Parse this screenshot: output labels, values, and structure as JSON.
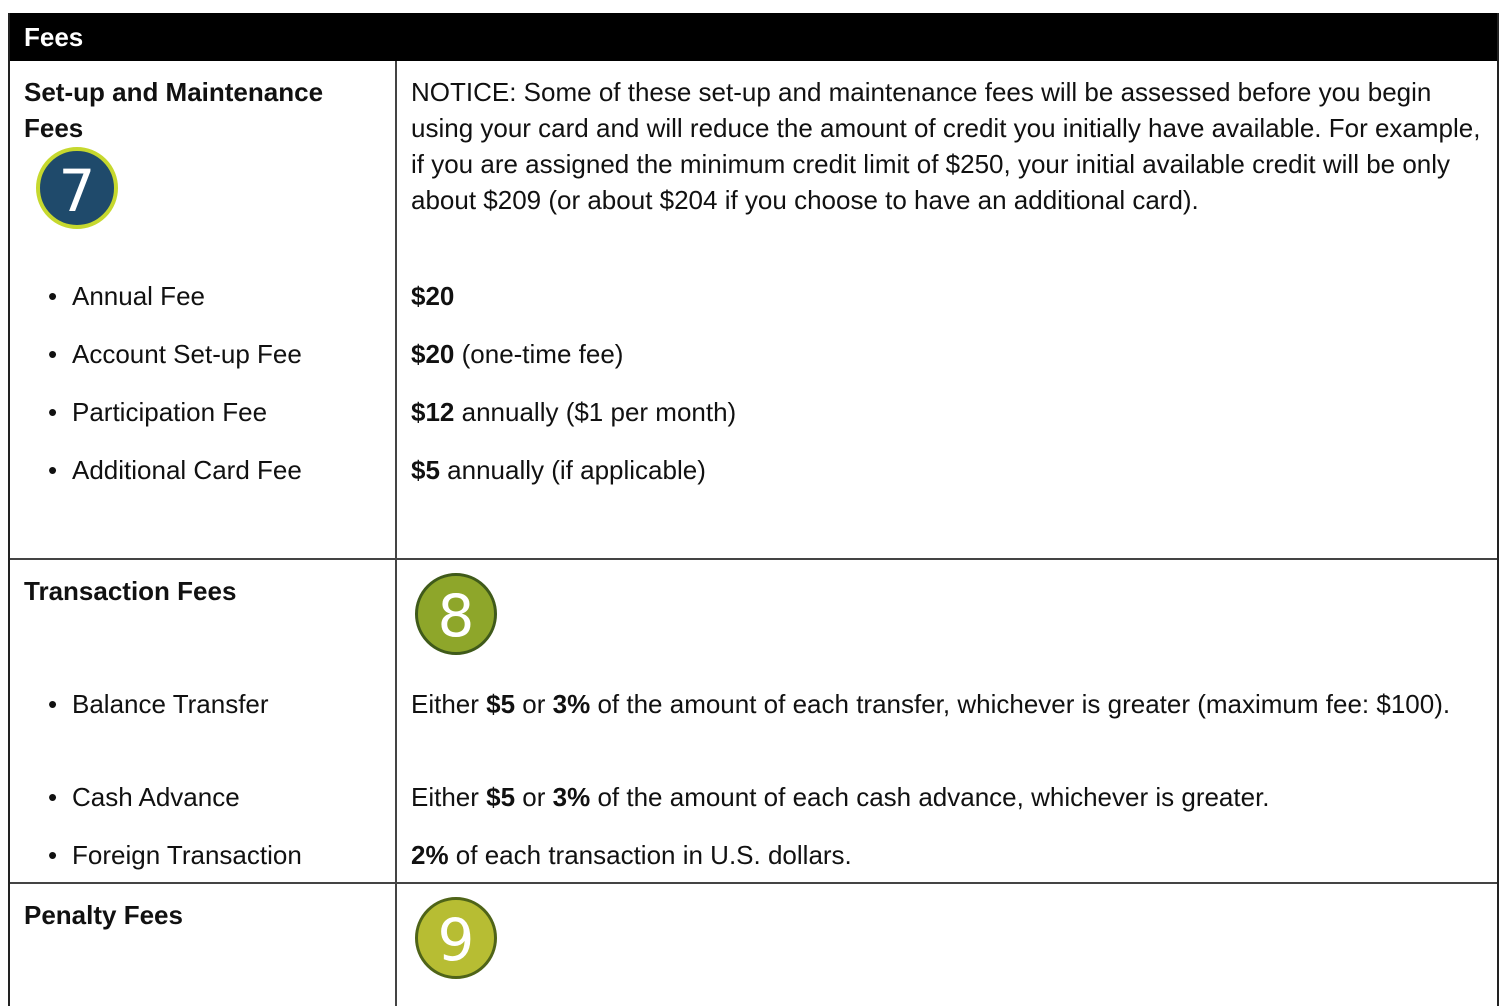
{
  "header": {
    "title": "Fees"
  },
  "setup": {
    "title": "Set-up and Maintenance Fees",
    "badge": "7",
    "notice": "NOTICE: Some of these set-up and maintenance fees will be assessed before you begin using your card and will reduce the amount of credit you initially have available.  For example, if you are assigned the minimum credit limit of $250, your initial available credit will be only about $209 (or about $204 if you choose to have an additional card).",
    "items": [
      {
        "label": "Annual Fee",
        "amount": "$20",
        "detail": ""
      },
      {
        "label": "Account Set-up Fee",
        "amount": "$20",
        "detail": " (one-time fee)"
      },
      {
        "label": "Participation Fee",
        "amount": "$12",
        "detail": " annually ($1 per month)"
      },
      {
        "label": "Additional Card Fee",
        "amount": "$5",
        "detail": " annually (if applicable)"
      }
    ]
  },
  "transaction": {
    "title": "Transaction Fees",
    "badge": "8",
    "items": [
      {
        "label": "Balance Transfer",
        "p1": "Either ",
        "b1": "$5",
        "p2": " or ",
        "b2": "3%",
        "p3": " of the amount of each transfer, whichever is greater (maximum fee: $100)."
      },
      {
        "label": "Cash Advance",
        "p1": "Either ",
        "b1": "$5",
        "p2": " or ",
        "b2": "3%",
        "p3": " of the amount of each cash advance, whichever is greater."
      },
      {
        "label": "Foreign Transaction",
        "b1": "2%",
        "p1": " of each transaction in U.S. dollars."
      }
    ]
  },
  "penalty": {
    "title": "Penalty Fees",
    "badge": "9"
  },
  "colors": {
    "header_bg": "#000000",
    "badge7_fill": "#1f4a6b",
    "badge7_ring": "#c6d82e",
    "badge8_fill": "#8ea62a",
    "badge9_fill": "#b7bd33"
  }
}
